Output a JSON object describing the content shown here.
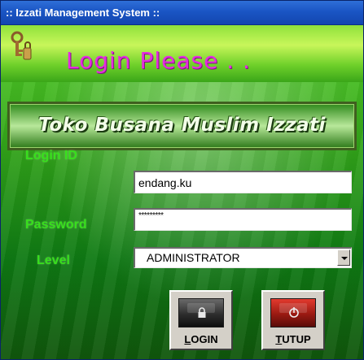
{
  "window": {
    "title": ":: Izzati Management System ::"
  },
  "header": {
    "heading": "Login Please . .",
    "icon": "keys-lock-icon"
  },
  "banner": {
    "text": "Toko Busana Muslim Izzati"
  },
  "form": {
    "login_id_label": "Login ID",
    "login_id_value": "endang.ku",
    "password_label": "Password",
    "password_value": "*********",
    "level_label": "Level",
    "level_value": "ADMINISTRATOR"
  },
  "buttons": {
    "login": {
      "mnemonic": "L",
      "rest": "OGIN",
      "icon": "lock-icon"
    },
    "exit": {
      "mnemonic": "T",
      "rest": "UTUP",
      "icon": "power-icon"
    }
  },
  "colors": {
    "title_bar": "#1a55c4",
    "heading": "#e52ce0",
    "label": "#38e01c",
    "exit_button": "#c0281e"
  }
}
